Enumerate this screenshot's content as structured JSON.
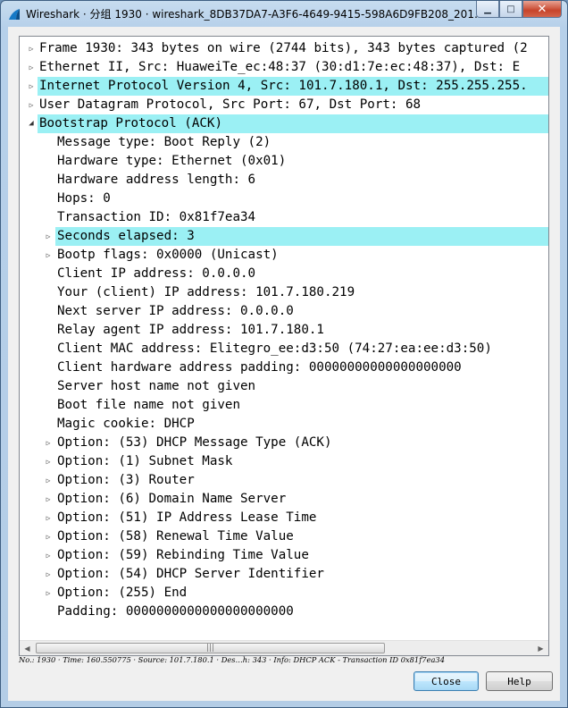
{
  "window": {
    "title": "Wireshark · 分组 1930 · wireshark_8DB37DA7-A3F6-4649-9415-598A6D9FB208_201…",
    "app_icon": "wireshark-fin-icon",
    "minimize_glyph": "▁",
    "maximize_glyph": "□",
    "close_glyph": "✕"
  },
  "colors": {
    "highlight": "#9bf0f4",
    "titlebar": "#b9d1ea",
    "close_button": "#c7442b"
  },
  "tree": {
    "rows": [
      {
        "level": 0,
        "state": "collapsed",
        "highlight": false,
        "text": "Frame 1930: 343 bytes on wire (2744 bits), 343 bytes captured (2"
      },
      {
        "level": 0,
        "state": "collapsed",
        "highlight": false,
        "text": "Ethernet II, Src: HuaweiTe_ec:48:37 (30:d1:7e:ec:48:37), Dst: E"
      },
      {
        "level": 0,
        "state": "collapsed",
        "highlight": true,
        "text": "Internet Protocol Version 4, Src: 101.7.180.1, Dst: 255.255.255."
      },
      {
        "level": 0,
        "state": "collapsed",
        "highlight": false,
        "text": "User Datagram Protocol, Src Port: 67, Dst Port: 68"
      },
      {
        "level": 0,
        "state": "expanded",
        "highlight": true,
        "text": "Bootstrap Protocol (ACK)"
      },
      {
        "level": 1,
        "state": "leaf",
        "highlight": false,
        "text": "Message type: Boot Reply (2)"
      },
      {
        "level": 1,
        "state": "leaf",
        "highlight": false,
        "text": "Hardware type: Ethernet (0x01)"
      },
      {
        "level": 1,
        "state": "leaf",
        "highlight": false,
        "text": "Hardware address length: 6"
      },
      {
        "level": 1,
        "state": "leaf",
        "highlight": false,
        "text": "Hops: 0"
      },
      {
        "level": 1,
        "state": "leaf",
        "highlight": false,
        "text": "Transaction ID: 0x81f7ea34"
      },
      {
        "level": 1,
        "state": "collapsed",
        "highlight": true,
        "text": "Seconds elapsed: 3"
      },
      {
        "level": 1,
        "state": "collapsed",
        "highlight": false,
        "text": "Bootp flags: 0x0000 (Unicast)"
      },
      {
        "level": 1,
        "state": "leaf",
        "highlight": false,
        "text": "Client IP address: 0.0.0.0"
      },
      {
        "level": 1,
        "state": "leaf",
        "highlight": false,
        "text": "Your (client) IP address: 101.7.180.219"
      },
      {
        "level": 1,
        "state": "leaf",
        "highlight": false,
        "text": "Next server IP address: 0.0.0.0"
      },
      {
        "level": 1,
        "state": "leaf",
        "highlight": false,
        "text": "Relay agent IP address: 101.7.180.1"
      },
      {
        "level": 1,
        "state": "leaf",
        "highlight": false,
        "text": "Client MAC address: Elitegro_ee:d3:50 (74:27:ea:ee:d3:50)"
      },
      {
        "level": 1,
        "state": "leaf",
        "highlight": false,
        "text": "Client hardware address padding: 00000000000000000000"
      },
      {
        "level": 1,
        "state": "leaf",
        "highlight": false,
        "text": "Server host name not given"
      },
      {
        "level": 1,
        "state": "leaf",
        "highlight": false,
        "text": "Boot file name not given"
      },
      {
        "level": 1,
        "state": "leaf",
        "highlight": false,
        "text": "Magic cookie: DHCP"
      },
      {
        "level": 1,
        "state": "collapsed",
        "highlight": false,
        "text": "Option: (53) DHCP Message Type (ACK)"
      },
      {
        "level": 1,
        "state": "collapsed",
        "highlight": false,
        "text": "Option: (1) Subnet Mask"
      },
      {
        "level": 1,
        "state": "collapsed",
        "highlight": false,
        "text": "Option: (3) Router"
      },
      {
        "level": 1,
        "state": "collapsed",
        "highlight": false,
        "text": "Option: (6) Domain Name Server"
      },
      {
        "level": 1,
        "state": "collapsed",
        "highlight": false,
        "text": "Option: (51) IP Address Lease Time"
      },
      {
        "level": 1,
        "state": "collapsed",
        "highlight": false,
        "text": "Option: (58) Renewal Time Value"
      },
      {
        "level": 1,
        "state": "collapsed",
        "highlight": false,
        "text": "Option: (59) Rebinding Time Value"
      },
      {
        "level": 1,
        "state": "collapsed",
        "highlight": false,
        "text": "Option: (54) DHCP Server Identifier"
      },
      {
        "level": 1,
        "state": "collapsed",
        "highlight": false,
        "text": "Option: (255) End"
      },
      {
        "level": 1,
        "state": "leaf",
        "highlight": false,
        "text": "Padding: 0000000000000000000000"
      }
    ]
  },
  "scrollbar": {
    "left_arrow": "◀",
    "right_arrow": "▶",
    "grip": "|||"
  },
  "status_bar": {
    "text": "No.: 1930 · Time: 160.550775 · Source: 101.7.180.1 · Des…h: 343 · Info: DHCP ACK - Transaction ID 0x81f7ea34"
  },
  "buttons": {
    "close_label": "Close",
    "help_label": "Help"
  }
}
